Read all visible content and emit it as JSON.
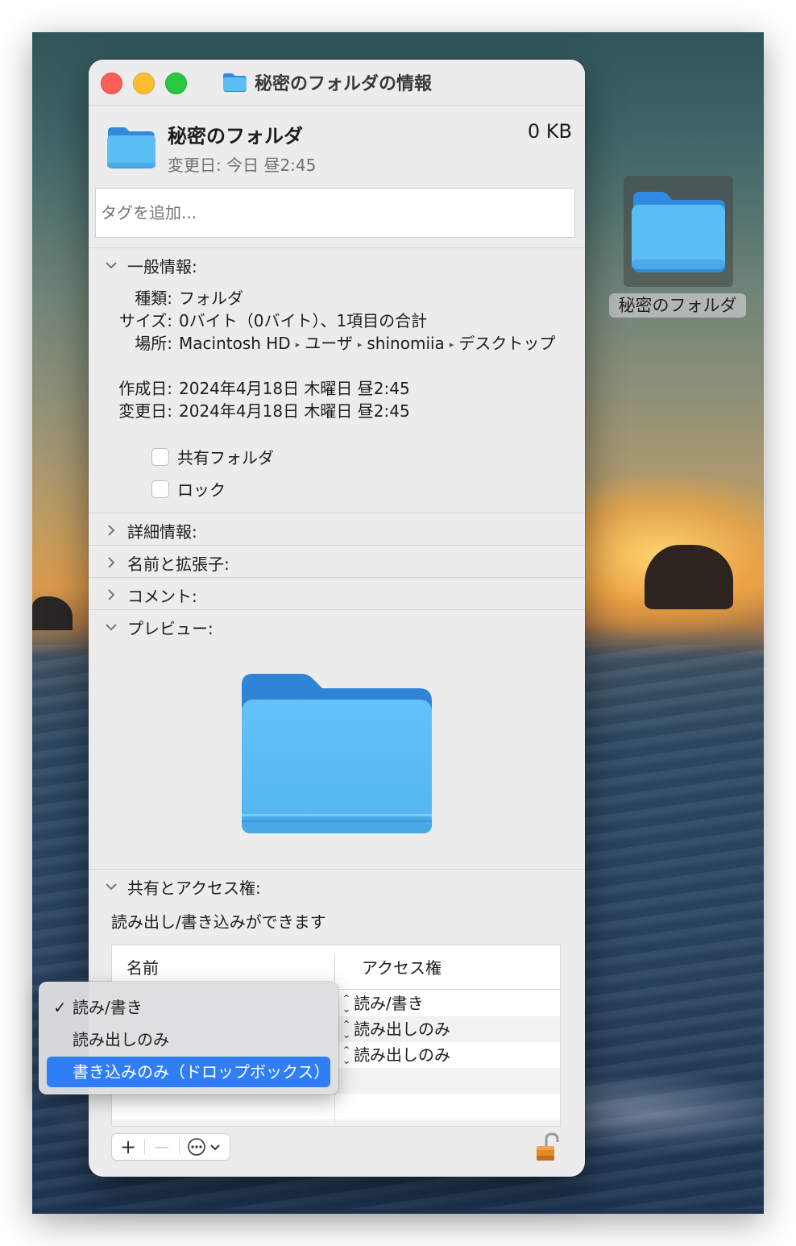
{
  "window": {
    "title": "秘密のフォルダの情報"
  },
  "header": {
    "name": "秘密のフォルダ",
    "size": "0 KB",
    "modified": "変更日: 今日 昼2:45",
    "tags_placeholder": "タグを追加..."
  },
  "general": {
    "heading": "一般情報:",
    "rows": [
      {
        "label": "種類:",
        "value": "フォルダ"
      },
      {
        "label": "サイズ:",
        "value": "0バイト（0バイト）、1項目の合計"
      },
      {
        "label": "場所:",
        "path": [
          "Macintosh HD",
          "ユーザ",
          "shinomiia",
          "デスクトップ"
        ],
        "path_wrap": "ップ"
      },
      {
        "label": "作成日:",
        "value": "2024年4月18日 木曜日 昼2:45"
      },
      {
        "label": "変更日:",
        "value": "2024年4月18日 木曜日 昼2:45"
      }
    ],
    "path_separator": "▸",
    "shared_folder": "共有フォルダ",
    "locked": "ロック"
  },
  "sections": {
    "more_info": "詳細情報:",
    "name_ext": "名前と拡張子:",
    "comments": "コメント:",
    "preview": "プレビュー:",
    "sharing": "共有とアクセス権:"
  },
  "sharing": {
    "description": "読み出し/書き込みができます",
    "col_name": "名前",
    "col_access": "アクセス権",
    "rows": [
      "読み/書き",
      "読み出しのみ",
      "読み出しのみ"
    ]
  },
  "toolbar": {
    "add": "+",
    "remove": "—"
  },
  "popup_menu": {
    "items": [
      "読み/書き",
      "読み出しのみ",
      "書き込みのみ（ドロップボックス）"
    ],
    "checked_index": 0,
    "highlighted_index": 2,
    "check_mark": "✓"
  },
  "desktop": {
    "icon_label": "秘密のフォルダ"
  },
  "colors": {
    "folder_blue": "#5bbef5",
    "selection": "#2f7ef6"
  }
}
